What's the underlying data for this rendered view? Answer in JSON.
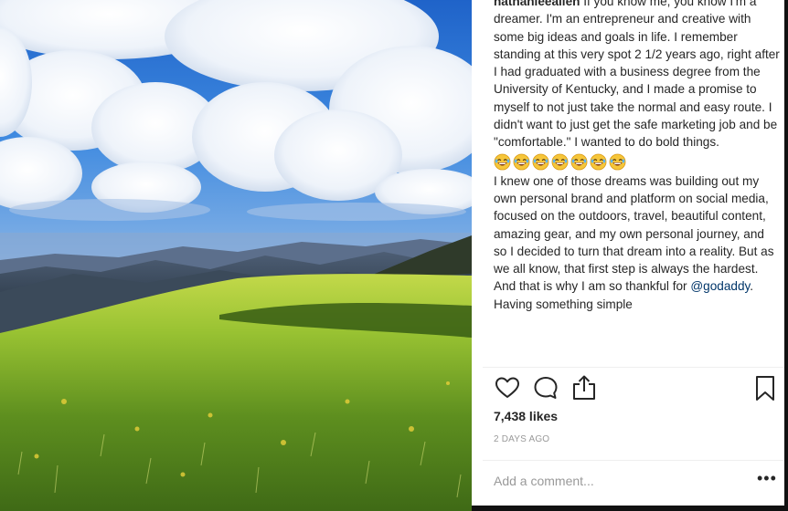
{
  "post": {
    "username": "nathanleeallen",
    "caption_part1": "If you know me, you know I'm a dreamer. I'm an entrepreneur and creative with some big ideas and goals in life. I remember standing at this very spot 2 1/2 years ago, right after I had graduated with a business degree from the University of Kentucky, and I made a promise to myself to not just take the normal and easy route. I didn't want to just get the safe marketing job and be \"comfortable.\" I wanted to do bold things.",
    "emoji_name": "laughing-emoji",
    "emoji_count": 7,
    "caption_part2": "I knew one of those dreams was building out my own personal brand and platform on social media, focused on the outdoors, travel, beautiful content, amazing gear, and my own personal journey, and so I decided to turn that dream into a reality. But as we all know, that first step is always the hardest. And that is why I am so thankful for ",
    "mention": "@godaddy",
    "caption_part3": ". Having something simple",
    "likes": "7,438 likes",
    "date": "2 DAYS AGO",
    "comment_placeholder": "Add a comment...",
    "more_label": "•••"
  },
  "icons": {
    "like": "heart-outline-icon",
    "comment": "comment-bubble-icon",
    "share": "share-upload-icon",
    "save": "bookmark-icon"
  },
  "colors": {
    "text": "#262626",
    "muted": "#999999",
    "mention": "#003569",
    "sky": "#2f7fd6",
    "grass": "#8fbf2a"
  }
}
